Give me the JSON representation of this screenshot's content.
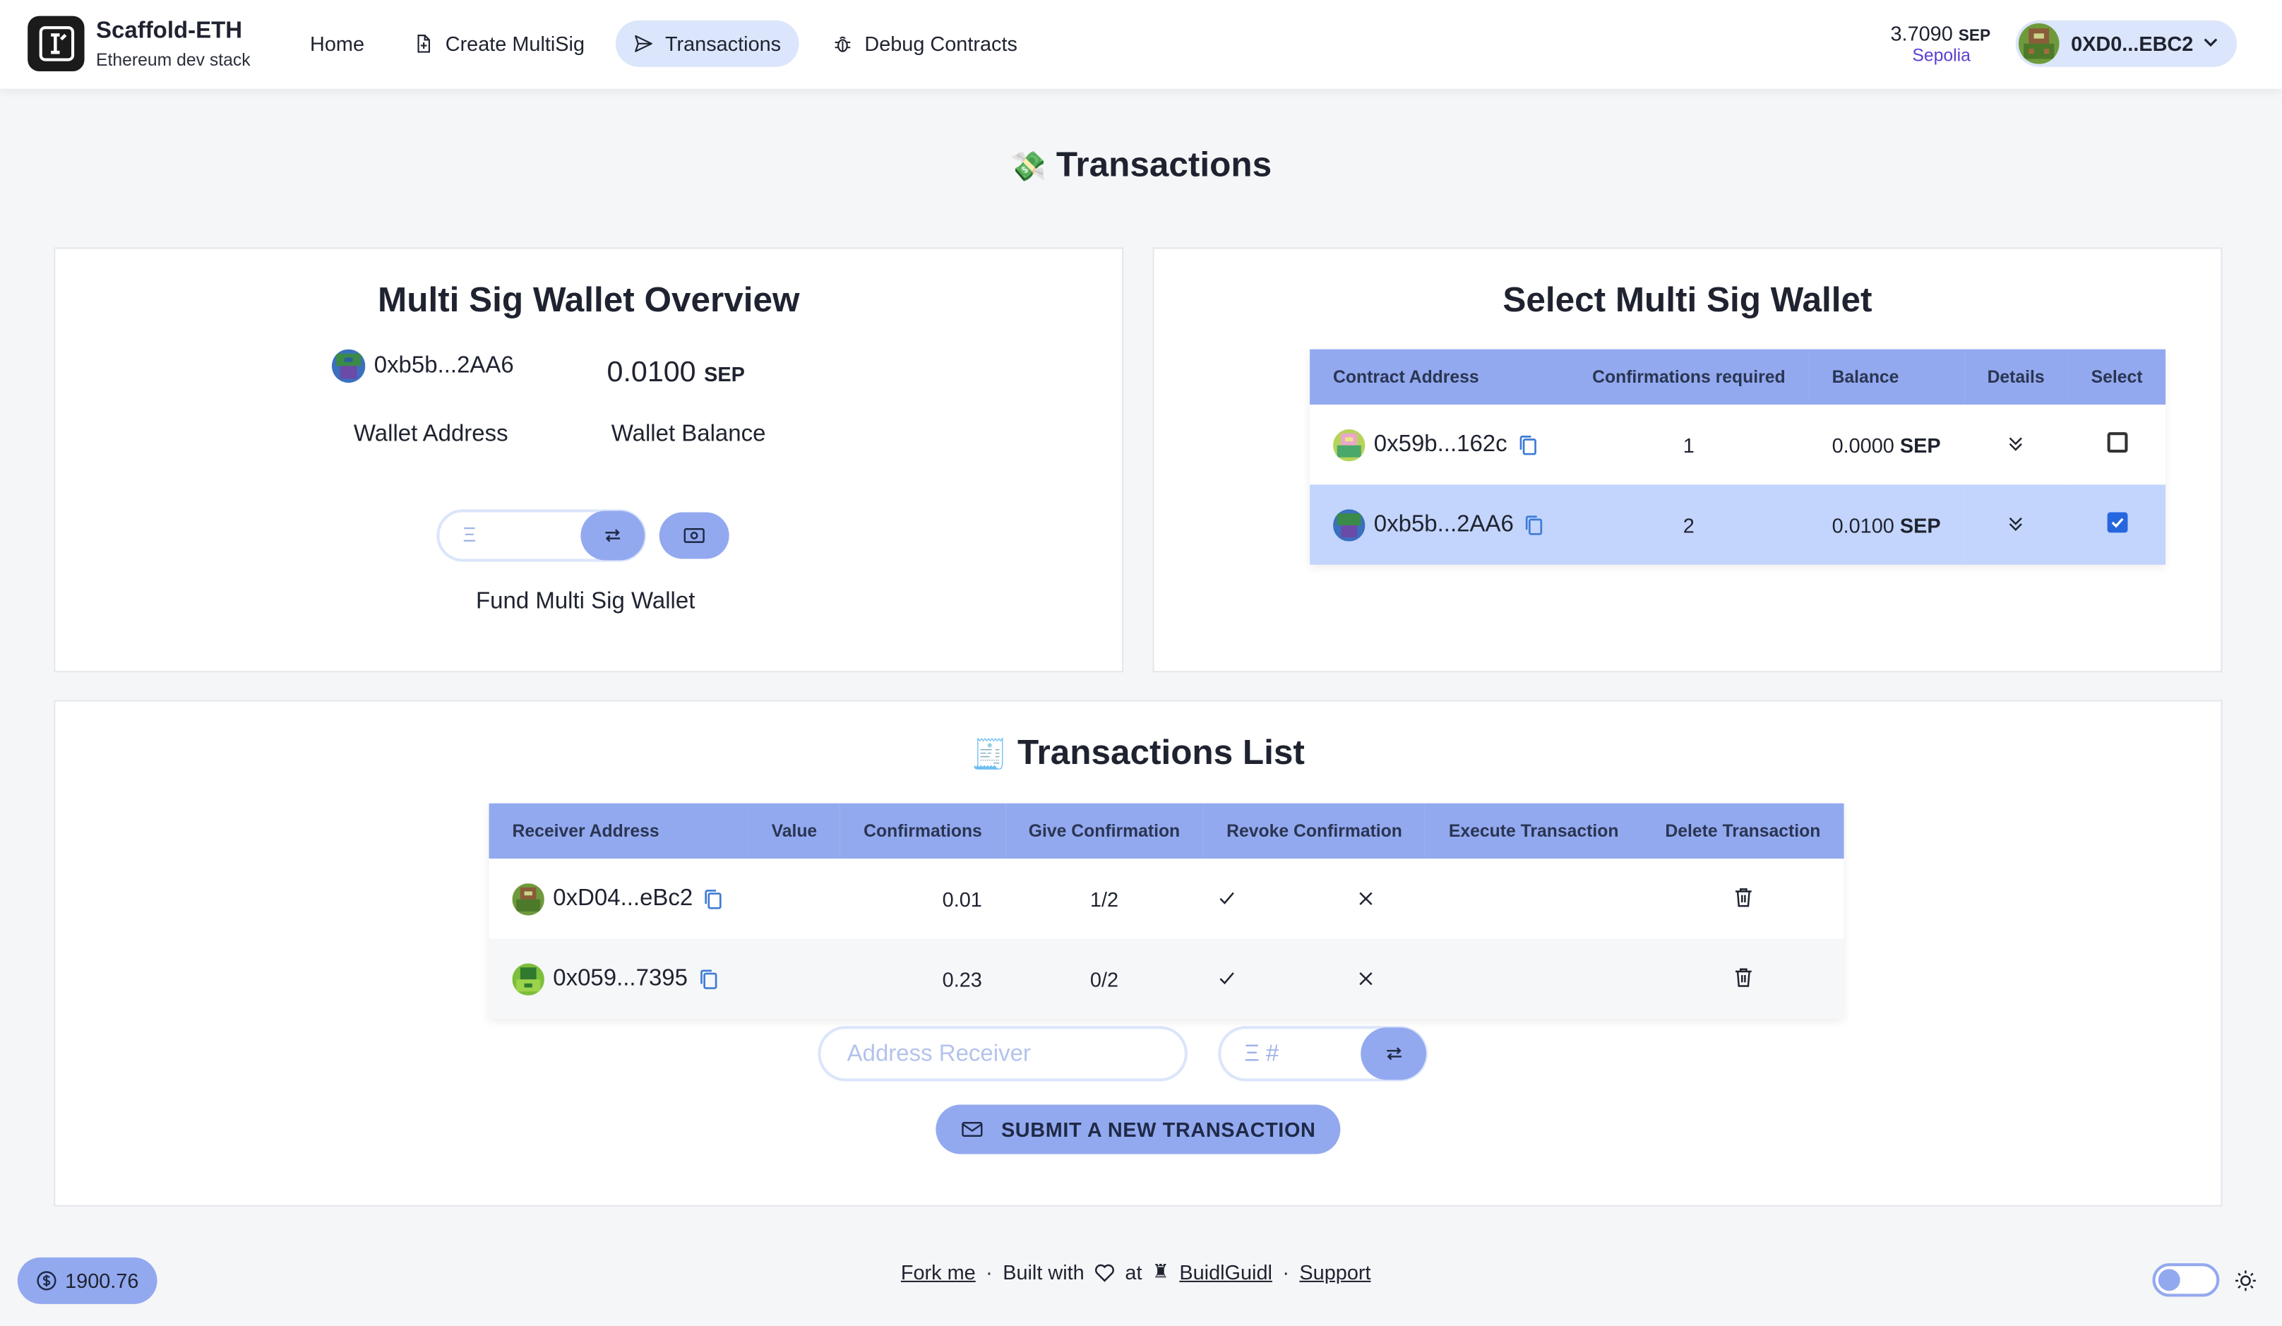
{
  "app": {
    "brand_title": "Scaffold-ETH",
    "brand_subtitle": "Ethereum dev stack"
  },
  "nav": {
    "items": [
      {
        "label": "Home",
        "icon": "none"
      },
      {
        "label": "Create MultiSig",
        "icon": "document-plus-icon"
      },
      {
        "label": "Transactions",
        "icon": "paper-plane-icon",
        "active": true
      },
      {
        "label": "Debug Contracts",
        "icon": "bug-icon"
      }
    ]
  },
  "account": {
    "balance": "3.7090",
    "unit": "SEP",
    "network": "Sepolia",
    "address": "0XD0...EBC2"
  },
  "page": {
    "title": "Transactions",
    "title_emoji": "money-with-wings-icon"
  },
  "overview": {
    "title": "Multi Sig Wallet Overview",
    "address": "0xb5b...2AA6",
    "balance": "0.0100",
    "balance_unit": "SEP",
    "address_label": "Wallet Address",
    "balance_label": "Wallet Balance",
    "fund_placeholder": "Ξ",
    "fund_label": "Fund Multi Sig Wallet"
  },
  "select_wallet": {
    "title": "Select Multi Sig Wallet",
    "columns": [
      "Contract Address",
      "Confirmations required",
      "Balance",
      "Details",
      "Select"
    ],
    "rows": [
      {
        "address": "0x59b...162c",
        "confirmations": "1",
        "balance": "0.0000",
        "unit": "SEP",
        "selected": false
      },
      {
        "address": "0xb5b...2AA6",
        "confirmations": "2",
        "balance": "0.0100",
        "unit": "SEP",
        "selected": true
      }
    ]
  },
  "tx_list": {
    "title": "Transactions List",
    "title_emoji": "receipt-icon",
    "columns": [
      "Receiver Address",
      "Value",
      "Confirmations",
      "Give Confirmation",
      "Revoke Confirmation",
      "Execute Transaction",
      "Delete Transaction"
    ],
    "rows": [
      {
        "address": "0xD04...eBc2",
        "value": "0.01",
        "confirmations": "1/2"
      },
      {
        "address": "0x059...7395",
        "value": "0.23",
        "confirmations": "0/2"
      }
    ],
    "address_placeholder": "Address Receiver",
    "value_placeholder": "Ξ #",
    "submit_label": "SUBMIT A NEW TRANSACTION"
  },
  "footer": {
    "price": "1900.76",
    "fork": "Fork me",
    "sep": "·",
    "built_with": "Built with",
    "at": "at",
    "buidlguidl": "BuidlGuidl",
    "support": "Support"
  },
  "colors": {
    "accent": "#93a9ef",
    "accent_light": "#dbe5fb",
    "selected_row": "#c3d5fc",
    "network": "#5b3fd0"
  }
}
